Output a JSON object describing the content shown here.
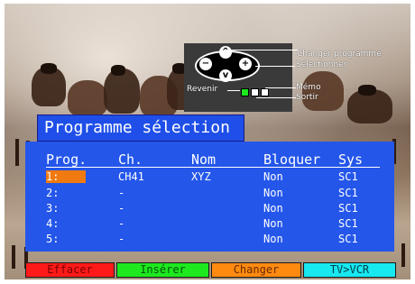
{
  "colors": {
    "title_bg": "#1f4fe8",
    "table_bg": "#2456ea",
    "highlight": "#f07a10",
    "key_red": "#ff1a1a",
    "key_green": "#1ee81e",
    "key_orange": "#ff8a10",
    "key_cyan": "#18e8f0"
  },
  "remote_help": {
    "changer_programme": "Changer programme",
    "selectionner": "Sélectionner",
    "revenir": "Revenir",
    "memo": "Mémo",
    "sortir": "Sortir",
    "up_symbol": "^",
    "down_symbol": "v",
    "minus_symbol": "−",
    "plus_symbol": "+"
  },
  "title": "Programme sélection",
  "table": {
    "headers": {
      "prog": "Prog.",
      "ch": "Ch.",
      "nom": "Nom",
      "bloquer": "Bloquer",
      "sys": "Sys"
    },
    "rows": [
      {
        "prog": "1:",
        "ch": "CH41",
        "nom": "XYZ",
        "bloquer": "Non",
        "sys": "SC1",
        "selected": true
      },
      {
        "prog": "2:",
        "ch": "-",
        "nom": "",
        "bloquer": "Non",
        "sys": "SC1",
        "selected": false
      },
      {
        "prog": "3:",
        "ch": "-",
        "nom": "",
        "bloquer": "Non",
        "sys": "SC1",
        "selected": false
      },
      {
        "prog": "4:",
        "ch": "-",
        "nom": "",
        "bloquer": "Non",
        "sys": "SC1",
        "selected": false
      },
      {
        "prog": "5:",
        "ch": "-",
        "nom": "",
        "bloquer": "Non",
        "sys": "SC1",
        "selected": false
      }
    ]
  },
  "keys": {
    "red": "Effacer",
    "green": "Insérer",
    "orange": "Changer",
    "cyan": "TV>VCR"
  }
}
